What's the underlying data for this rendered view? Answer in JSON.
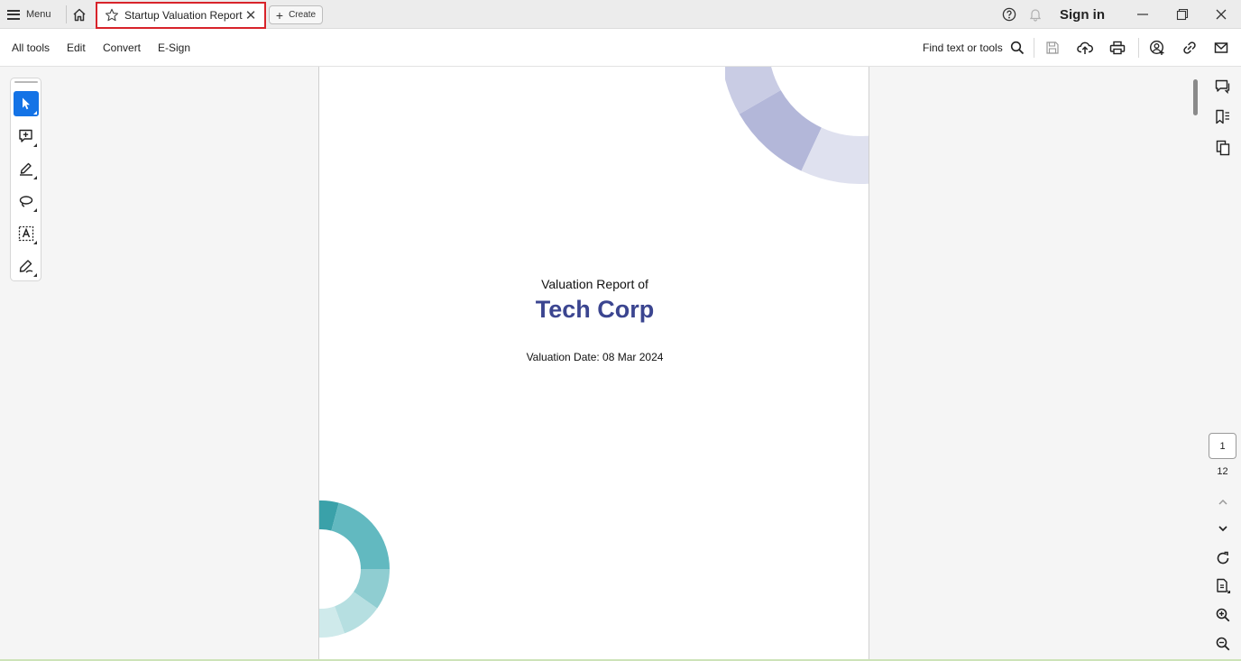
{
  "titlebar": {
    "menu_label": "Menu",
    "tab_title": "Startup Valuation Report",
    "tab_close": "✕",
    "create_label": "Create",
    "sign_in": "Sign in"
  },
  "toolbar": {
    "menus": [
      "All tools",
      "Edit",
      "Convert",
      "E-Sign"
    ],
    "find_label": "Find text or tools"
  },
  "document": {
    "subtitle": "Valuation Report of",
    "company": "Tech Corp",
    "valuation_date": "Valuation Date: 08 Mar 2024",
    "colors": {
      "company": "#3b4590",
      "ring_top": [
        "#b3b7d9",
        "#c9cce4",
        "#dfe1ef"
      ],
      "ring_bottom": [
        "#3aa1a9",
        "#62b9c0",
        "#8fcdd1",
        "#b6dfe1",
        "#cfeaeb"
      ]
    }
  },
  "navigation": {
    "current_page": "1",
    "total_pages": "12"
  },
  "icons": {
    "left_rail": [
      "select-cursor-icon",
      "add-comment-icon",
      "highlight-pen-icon",
      "lasso-draw-icon",
      "text-recognition-icon",
      "fill-sign-icon"
    ],
    "right_rail": [
      "comments-icon",
      "bookmarks-icon",
      "pages-icon",
      "rotate-icon",
      "fit-page-icon",
      "zoom-in-icon",
      "zoom-out-icon"
    ],
    "toolbar_right": [
      "search-icon",
      "save-icon",
      "upload-cloud-icon",
      "print-icon",
      "share-user-icon",
      "link-icon",
      "email-icon"
    ]
  },
  "colors": {
    "accent": "#1473e6",
    "tab_highlight": "#d8232a"
  }
}
